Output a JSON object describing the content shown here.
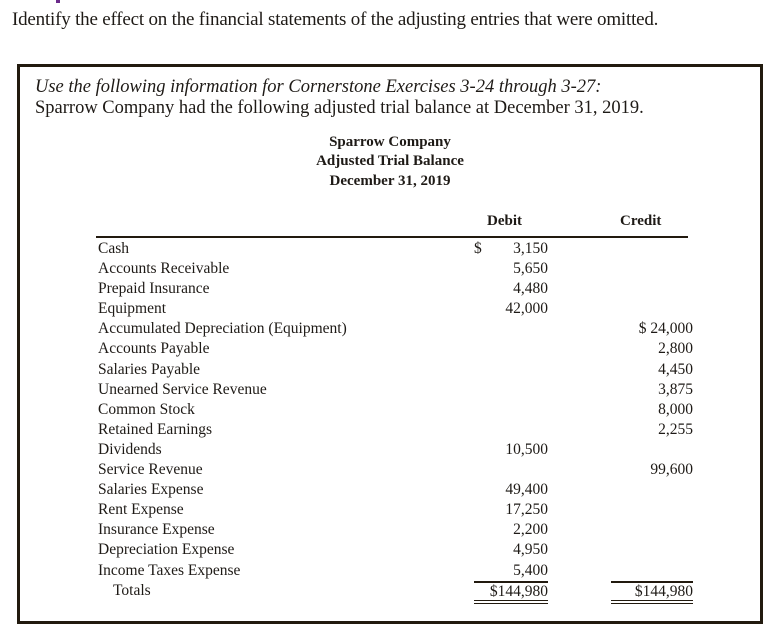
{
  "question": "Identify the effect on the financial statements of the adjusting entries that were omitted.",
  "box": {
    "intro_italic": "Use the following information for Cornerstone Exercises 3-24 through 3-27:",
    "intro": "Sparrow Company had the following adjusted trial balance at December 31, 2019.",
    "headings": [
      "Sparrow Company",
      "Adjusted Trial Balance",
      "December 31, 2019"
    ],
    "columns": {
      "debit": "Debit",
      "credit": "Credit"
    },
    "rows": [
      {
        "account": "Cash",
        "debit": "3,150",
        "debit_dollar": "$",
        "credit": ""
      },
      {
        "account": "Accounts Receivable",
        "debit": "5,650",
        "credit": ""
      },
      {
        "account": "Prepaid Insurance",
        "debit": "4,480",
        "credit": ""
      },
      {
        "account": "Equipment",
        "debit": "42,000",
        "credit": ""
      },
      {
        "account": "Accumulated Depreciation (Equipment)",
        "debit": "",
        "credit": "$ 24,000"
      },
      {
        "account": "Accounts Payable",
        "debit": "",
        "credit": "2,800"
      },
      {
        "account": "Salaries Payable",
        "debit": "",
        "credit": "4,450"
      },
      {
        "account": "Unearned Service Revenue",
        "debit": "",
        "credit": "3,875"
      },
      {
        "account": "Common Stock",
        "debit": "",
        "credit": "8,000"
      },
      {
        "account": "Retained Earnings",
        "debit": "",
        "credit": "2,255"
      },
      {
        "account": "Dividends",
        "debit": "10,500",
        "credit": ""
      },
      {
        "account": "Service Revenue",
        "debit": "",
        "credit": "99,600"
      },
      {
        "account": "Salaries Expense",
        "debit": "49,400",
        "credit": ""
      },
      {
        "account": "Rent Expense",
        "debit": "17,250",
        "credit": ""
      },
      {
        "account": "Insurance Expense",
        "debit": "2,200",
        "credit": ""
      },
      {
        "account": "Depreciation Expense",
        "debit": "4,950",
        "credit": ""
      },
      {
        "account": "Income Taxes Expense",
        "debit": "5,400",
        "credit": ""
      }
    ],
    "totals": {
      "label": "Totals",
      "debit": "$144,980",
      "credit": "$144,980"
    }
  }
}
